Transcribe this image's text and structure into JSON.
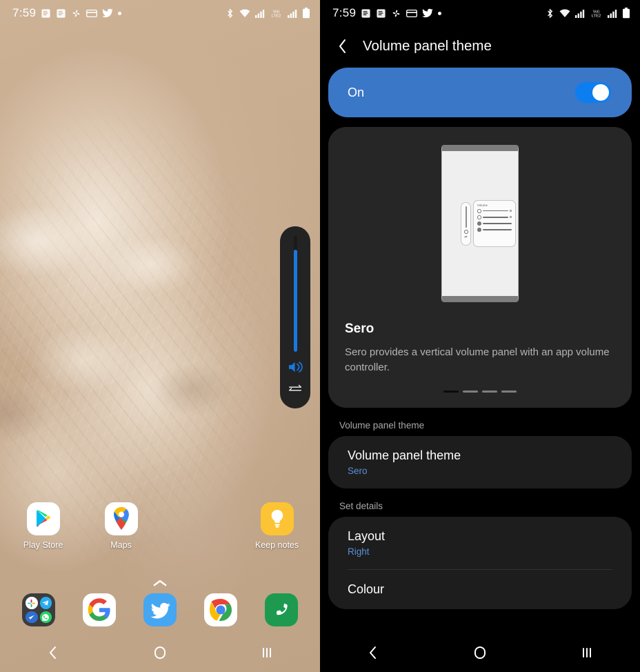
{
  "left_phone": {
    "status_bar": {
      "time": "7:59",
      "notification_icons": [
        "document-icon",
        "document-icon",
        "pinwheel-icon",
        "card-icon",
        "twitter-icon",
        "dot-icon"
      ],
      "system_icons": [
        "bluetooth-icon",
        "wifi-icon",
        "signal-icon",
        "volte-badge",
        "signal-icon",
        "battery-icon"
      ],
      "volte_label": "VoI)\nLTE2"
    },
    "volume_panel": {
      "level_percent": 88,
      "speaker_icon": "speaker-volume-icon",
      "swap_icon": "swap-arrows-icon"
    },
    "apps": [
      {
        "label": "Play Store",
        "icon": "play-store-icon"
      },
      {
        "label": "Maps",
        "icon": "google-maps-icon"
      },
      {
        "label": "",
        "icon": ""
      },
      {
        "label": "Keep notes",
        "icon": "keep-notes-icon"
      }
    ],
    "dock_arrow_icon": "chevron-up-icon",
    "dock": [
      {
        "label": "App folder",
        "icon": "app-folder-icon"
      },
      {
        "label": "Google",
        "icon": "google-icon"
      },
      {
        "label": "Twitter",
        "icon": "twitter-icon"
      },
      {
        "label": "Chrome",
        "icon": "chrome-icon"
      },
      {
        "label": "Phone",
        "icon": "phone-icon"
      }
    ],
    "nav_bar": [
      {
        "name": "back",
        "icon": "back-chevron-icon"
      },
      {
        "name": "home",
        "icon": "home-circle-icon"
      },
      {
        "name": "recents",
        "icon": "recents-bars-icon"
      }
    ]
  },
  "right_phone": {
    "status_bar": {
      "time": "7:59",
      "volte_label": "VoI)\nLTE2"
    },
    "header": {
      "back_icon": "back-chevron-icon",
      "title": "Volume panel theme"
    },
    "master_toggle": {
      "label": "On",
      "state": "on",
      "card_color": "#3b77c7",
      "switch_track_color": "#0d7ef0"
    },
    "preview": {
      "theme_name": "Sero",
      "description": "Sero provides a vertical volume panel with an app volume controller.",
      "mock_volume_title": "Volume",
      "page_indicator": {
        "count": 4,
        "active_index": 0
      }
    },
    "sections": [
      {
        "label": "Volume panel theme",
        "items": [
          {
            "title": "Volume panel theme",
            "value": "Sero"
          }
        ]
      },
      {
        "label": "Set details",
        "items": [
          {
            "title": "Layout",
            "value": "Right"
          },
          {
            "title": "Colour",
            "value": ""
          }
        ]
      }
    ],
    "nav_bar": [
      {
        "name": "back",
        "icon": "back-chevron-icon"
      },
      {
        "name": "home",
        "icon": "home-circle-icon"
      },
      {
        "name": "recents",
        "icon": "recents-bars-icon"
      }
    ],
    "accent_color": "#5a8fd8"
  }
}
